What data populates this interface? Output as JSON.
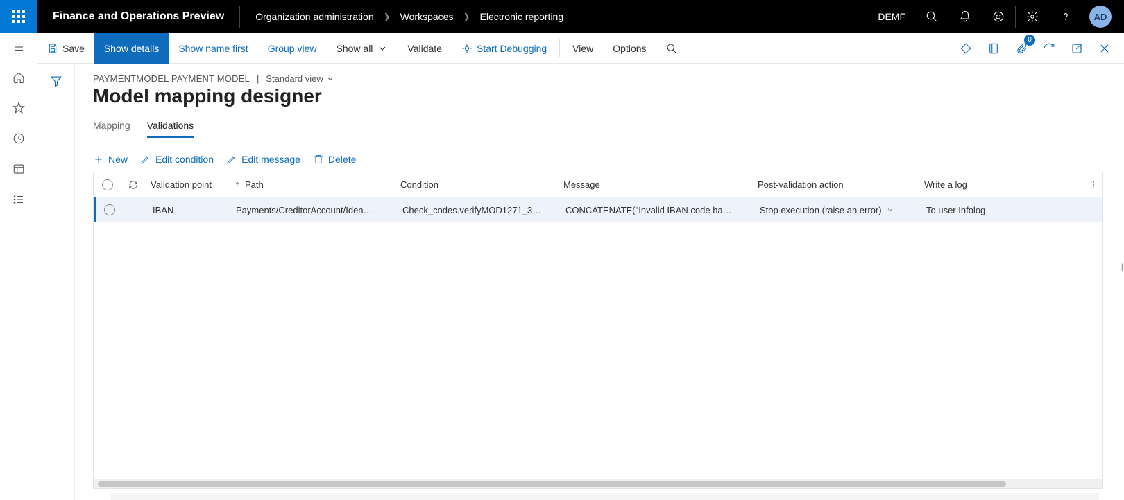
{
  "header": {
    "app_title": "Finance and Operations Preview",
    "breadcrumbs": [
      "Organization administration",
      "Workspaces",
      "Electronic reporting"
    ],
    "legal_entity": "DEMF",
    "avatar_initials": "AD"
  },
  "actionbar": {
    "save": "Save",
    "show_details": "Show details",
    "show_name_first": "Show name first",
    "group_view": "Group view",
    "show_all": "Show all",
    "validate": "Validate",
    "start_debugging": "Start Debugging",
    "view": "View",
    "options": "Options",
    "attachments_badge": "0"
  },
  "page": {
    "model_name": "PAYMENTMODEL PAYMENT MODEL",
    "view_name": "Standard view",
    "title": "Model mapping designer",
    "tabs": {
      "mapping": "Mapping",
      "validations": "Validations"
    },
    "active_tab": "validations"
  },
  "grid_toolbar": {
    "new": "New",
    "edit_condition": "Edit condition",
    "edit_message": "Edit message",
    "delete": "Delete"
  },
  "grid": {
    "columns": {
      "validation_point": "Validation point",
      "path": "Path",
      "condition": "Condition",
      "message": "Message",
      "post_validation_action": "Post-validation action",
      "write_a_log": "Write a log"
    },
    "rows": [
      {
        "validation_point": "IBAN",
        "path": "Payments/CreditorAccount/Iden…",
        "condition": "Check_codes.verifyMOD1271_3…",
        "message": "CONCATENATE(\"Invalid IBAN code ha…",
        "post_validation_action": "Stop execution (raise an error)",
        "write_a_log": "To user Infolog"
      }
    ]
  }
}
